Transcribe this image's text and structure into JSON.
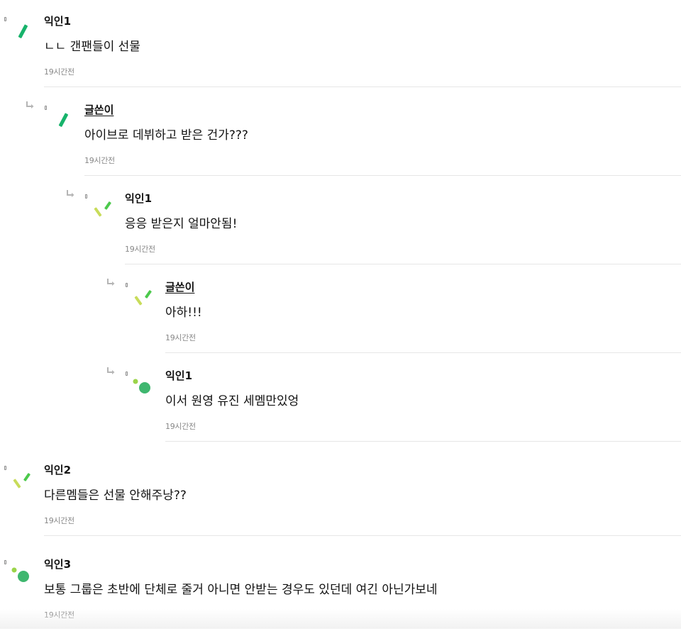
{
  "comments": [
    {
      "author": "익인1",
      "text": "ㄴㄴ 갠팬들이 선물",
      "time": "19시간전",
      "avatar": "dash-avatar",
      "colors": [
        "#17b36b"
      ]
    },
    {
      "author": "글쓴이",
      "text": "아이브로 데뷔하고 받은 건가???",
      "time": "19시간전",
      "avatar": "dash-avatar",
      "colors": [
        "#17b36b"
      ]
    },
    {
      "author": "익인1",
      "text": "응응 받은지 얼마안됨!",
      "time": "19시간전",
      "avatar": "sticks-avatar",
      "colors": [
        "#c8dc5a",
        "#4cc94c"
      ]
    },
    {
      "author": "글쓴이",
      "text": "아하!!!",
      "time": "19시간전",
      "avatar": "sticks-avatar",
      "colors": [
        "#c8dc5a",
        "#4cc94c"
      ]
    },
    {
      "author": "익인1",
      "text": "이서 원영 유진 세멤만있엉",
      "time": "19시간전",
      "avatar": "dots-avatar",
      "colors": [
        "#9bd44a",
        "#3fb76f"
      ]
    },
    {
      "author": "익인2",
      "text": "다른멤들은 선물 안해주낭??",
      "time": "19시간전",
      "avatar": "sticks-avatar",
      "colors": [
        "#c8dc5a",
        "#4cc94c"
      ]
    },
    {
      "author": "익인3",
      "text": "보통 그룹은 초반에 단체로 줄거 아니면 안받는 경우도 있던데 여긴 아닌가보네",
      "time": "19시간전",
      "avatar": "dots-avatar",
      "colors": [
        "#9bd44a",
        "#3fb76f"
      ]
    }
  ]
}
